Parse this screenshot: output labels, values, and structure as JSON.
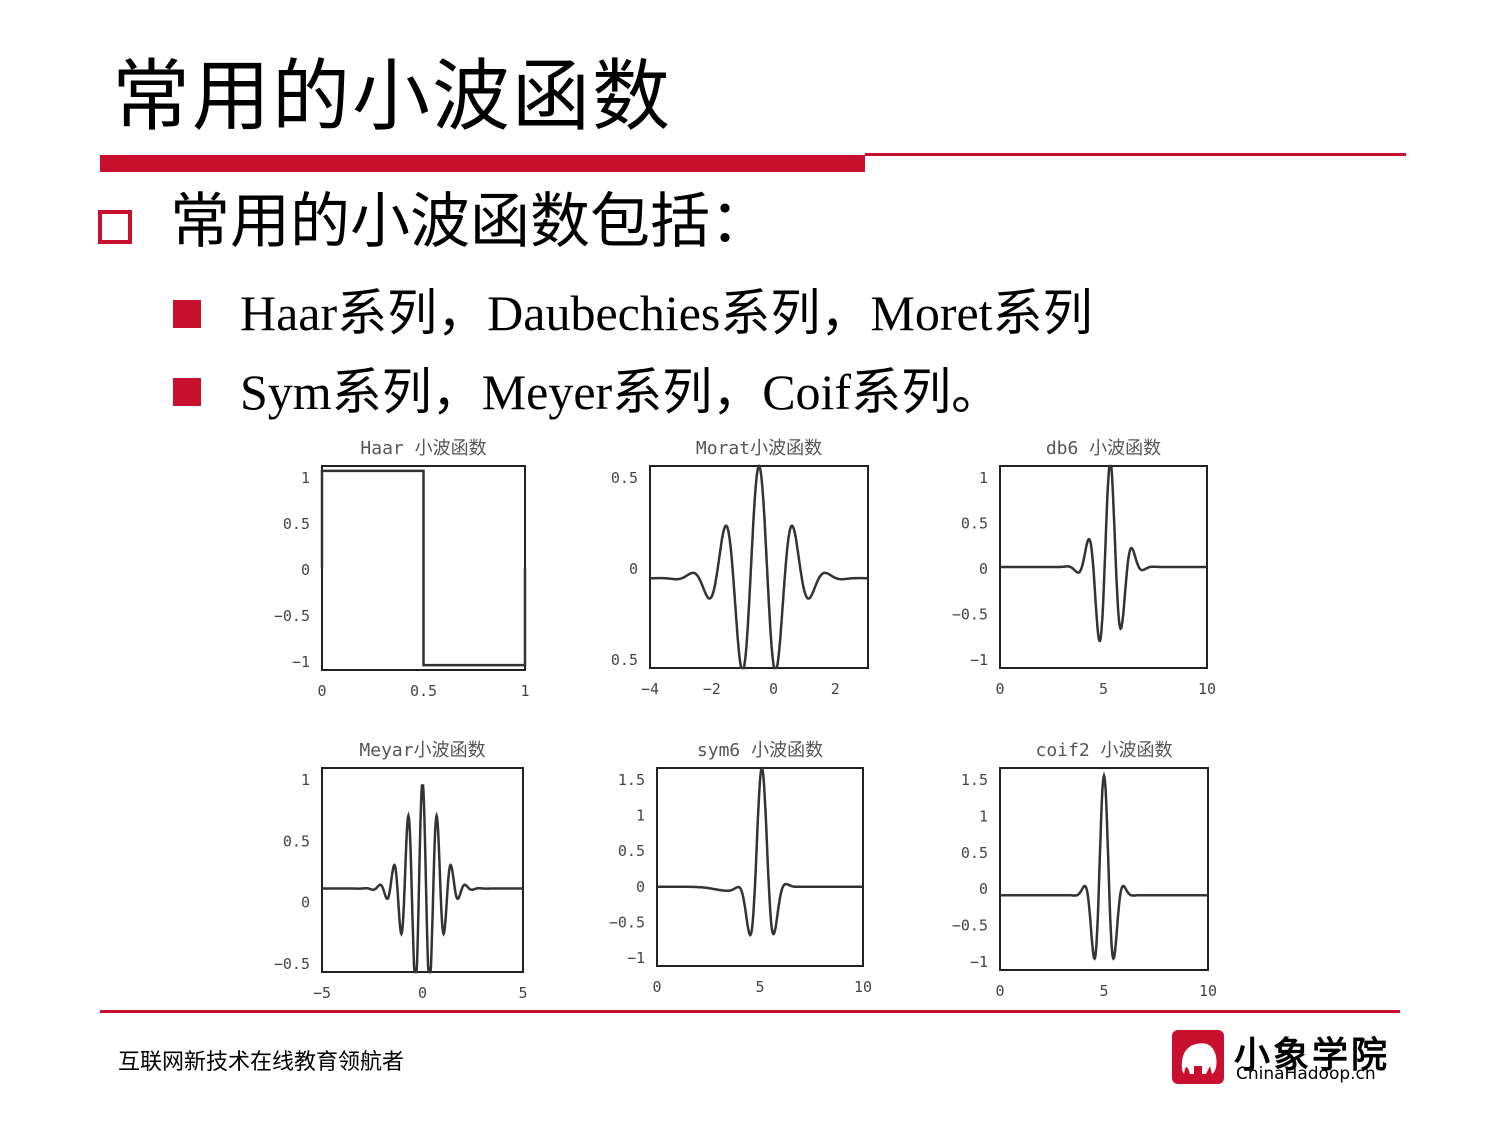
{
  "slide": {
    "title": "常用的小波函数",
    "bullet": "常用的小波函数包括：",
    "sub_bullets": [
      "Haar系列，Daubechies系列，Moret系列",
      "Sym系列，Meyer系列，Coif系列。"
    ],
    "footer_slogan": "互联网新技术在线教育领航者",
    "logo_cn": "小象学院",
    "logo_en": "ChinaHadoop.cn",
    "accent_color": "#c8102e"
  },
  "chart_data": [
    {
      "type": "line",
      "title": "Haar 小波函数",
      "xticks": [
        "0",
        "0.5",
        "1"
      ],
      "yticks": [
        "1",
        "0.5",
        "0",
        "−0.5",
        "−1"
      ],
      "xlim": [
        0,
        1
      ],
      "ylim": [
        -1.05,
        1.05
      ],
      "x": [
        0,
        0,
        0.5,
        0.5,
        1,
        1
      ],
      "y": [
        0,
        1,
        1,
        -1,
        -1,
        0
      ]
    },
    {
      "type": "line",
      "title": "Morat小波函数",
      "xticks": [
        "−4",
        "−2",
        "0",
        "2"
      ],
      "yticks": [
        "0.5",
        "0",
        "0.5"
      ],
      "xlim": [
        -4,
        4
      ],
      "ylim": [
        -0.8,
        1.0
      ],
      "function": "morlet"
    },
    {
      "type": "line",
      "title": "db6 小波函数",
      "xticks": [
        "0",
        "5",
        "10"
      ],
      "yticks": [
        "1",
        "0.5",
        "0",
        "−0.5",
        "−1"
      ],
      "xlim": [
        0,
        11
      ],
      "ylim": [
        -1.2,
        1.2
      ],
      "function": "db6"
    },
    {
      "type": "line",
      "title": "Meyar小波函数",
      "xticks": [
        "−5",
        "0",
        "5"
      ],
      "yticks": [
        "1",
        "0.5",
        "0",
        "−0.5"
      ],
      "xlim": [
        -8,
        8
      ],
      "ylim": [
        -0.9,
        1.3
      ],
      "function": "meyer"
    },
    {
      "type": "line",
      "title": "sym6 小波函数",
      "xticks": [
        "0",
        "5",
        "10"
      ],
      "yticks": [
        "1.5",
        "1",
        "0.5",
        "0",
        "−0.5",
        "−1"
      ],
      "xlim": [
        0,
        11
      ],
      "ylim": [
        -1.0,
        1.5
      ],
      "function": "sym6"
    },
    {
      "type": "line",
      "title": "coif2 小波函数",
      "xticks": [
        "0",
        "5",
        "10"
      ],
      "yticks": [
        "1.5",
        "1",
        "0.5",
        "0",
        "−0.5",
        "−1"
      ],
      "xlim": [
        0,
        11
      ],
      "ylim": [
        -1.0,
        1.7
      ],
      "function": "coif2"
    }
  ]
}
